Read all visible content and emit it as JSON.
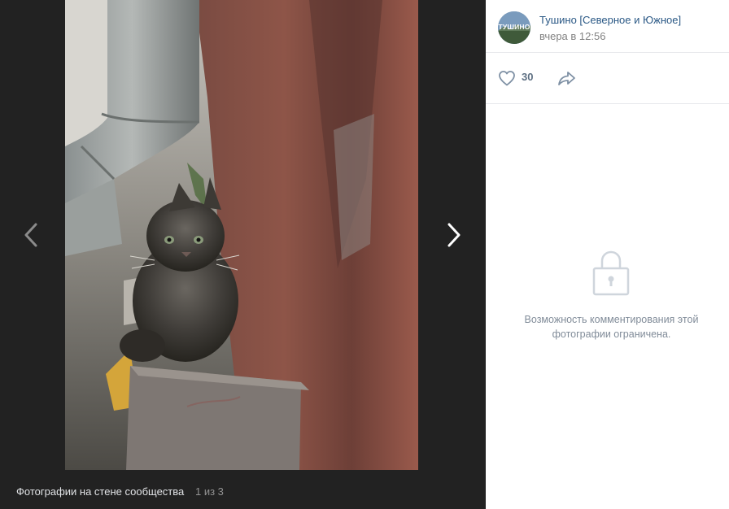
{
  "viewer": {
    "footer_title": "Фотографии на стене сообщества",
    "counter": "1 из 3",
    "photo_icon": "kitten-photo",
    "prev_icon": "chevron-left-icon",
    "next_icon": "chevron-right-icon"
  },
  "author": {
    "avatar_text": "ТУШИНО",
    "name": "Тушино [Северное и Южное]",
    "date": "вчера в 12:56"
  },
  "actions": {
    "likes": "30",
    "like_icon": "heart-icon",
    "share_icon": "share-icon"
  },
  "comments": {
    "closed_line1": "Возможность комментирования этой",
    "closed_line2": "фотографии ограничена.",
    "lock_icon": "lock-icon"
  },
  "colors": {
    "viewer_bg": "#222222",
    "link": "#2a5885",
    "muted": "#828282",
    "icon": "#5d6f82"
  }
}
